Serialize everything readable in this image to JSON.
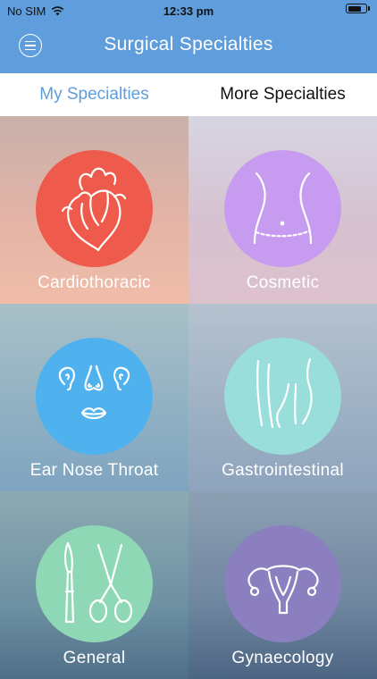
{
  "status_bar": {
    "carrier": "No SIM",
    "time": "12:33 pm",
    "battery_level": 0.8
  },
  "nav": {
    "title": "Surgical Specialties",
    "menu_icon": "hamburger-circle-icon"
  },
  "tabs": [
    {
      "label": "My Specialties",
      "active": true
    },
    {
      "label": "More Specialties",
      "active": false
    }
  ],
  "specialties": [
    {
      "label": "Cardiothoracic",
      "icon": "heart-icon",
      "color": "#ee5a4c"
    },
    {
      "label": "Cosmetic",
      "icon": "torso-icon",
      "color": "#c79cf0"
    },
    {
      "label": "Ear Nose Throat",
      "icon": "ear-nose-mouth-icon",
      "color": "#4fb2ee"
    },
    {
      "label": "Gastrointestinal",
      "icon": "intestine-icon",
      "color": "#9adedc"
    },
    {
      "label": "General",
      "icon": "scalpel-scissors-icon",
      "color": "#8fd8b6"
    },
    {
      "label": "Gynaecology",
      "icon": "uterus-icon",
      "color": "#8c7fc0"
    }
  ],
  "colors": {
    "accent": "#5f9ddc",
    "tab_inactive": "#111111",
    "tab_background": "#ffffff"
  }
}
